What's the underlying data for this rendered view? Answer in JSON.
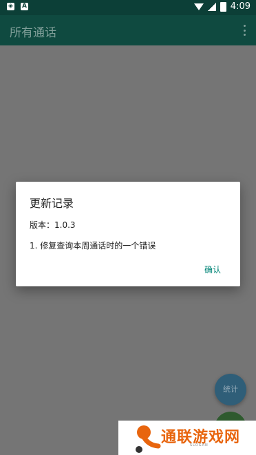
{
  "status_bar": {
    "time": "4:09",
    "icons": [
      "shield-icon",
      "a-icon",
      "wifi-icon",
      "no-signal-icon",
      "battery-icon"
    ],
    "a_glyph": "A"
  },
  "app_bar": {
    "title": "所有通话"
  },
  "dialog": {
    "title": "更新记录",
    "version": "版本：1.0.3",
    "note": "1. 修复查询本周通话时的一个错误",
    "confirm_label": "确认"
  },
  "fab": {
    "stats_label": "统计"
  },
  "watermark": {
    "text": "通联游戏网",
    "slogan": "SLOGAN"
  },
  "colors": {
    "accent": "#008577",
    "status_bar": "#0c3f37",
    "app_bar": "#0f4a40",
    "scrim_background": "#757575"
  }
}
